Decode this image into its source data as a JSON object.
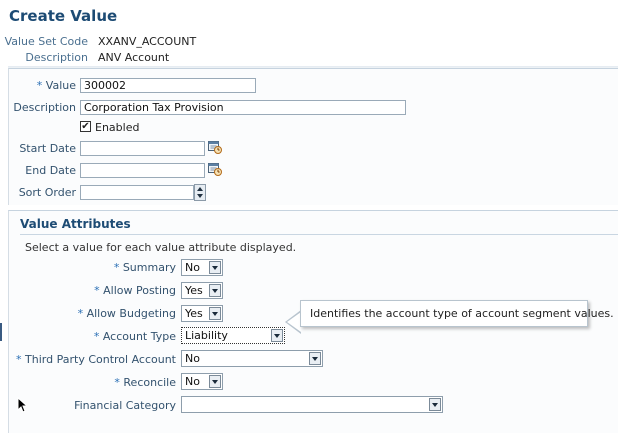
{
  "page": {
    "title": "Create Value"
  },
  "header": {
    "value_set_code_label": "Value Set Code",
    "value_set_code": "XXANV_ACCOUNT",
    "description_label": "Description",
    "description": "ANV Account"
  },
  "form": {
    "required_mark": "*",
    "value_label": "Value",
    "value": "300002",
    "description_label": "Description",
    "description": "Corporation Tax Provision",
    "enabled_label": "Enabled",
    "enabled_checked": true,
    "check_glyph": "✔",
    "start_date_label": "Start Date",
    "start_date": "",
    "end_date_label": "End Date",
    "end_date": "",
    "sort_order_label": "Sort Order",
    "sort_order": ""
  },
  "attributes": {
    "section_title": "Value Attributes",
    "hint": "Select a value for each value attribute displayed.",
    "summary_label": "Summary",
    "summary": "No",
    "allow_posting_label": "Allow Posting",
    "allow_posting": "Yes",
    "allow_budgeting_label": "Allow Budgeting",
    "allow_budgeting": "Yes",
    "account_type_label": "Account Type",
    "account_type": "Liability",
    "third_party_label": "Third Party Control Account",
    "third_party": "No",
    "reconcile_label": "Reconcile",
    "reconcile": "No",
    "financial_category_label": "Financial Category",
    "financial_category": ""
  },
  "tooltip": {
    "text": "Identifies the account type of account segment values."
  },
  "icons": {
    "calendar": "calendar-icon",
    "dropdown": "chevron-down-icon"
  },
  "colors": {
    "title": "#1d4b74",
    "required": "#2a6fb5",
    "label": "#33526e"
  }
}
